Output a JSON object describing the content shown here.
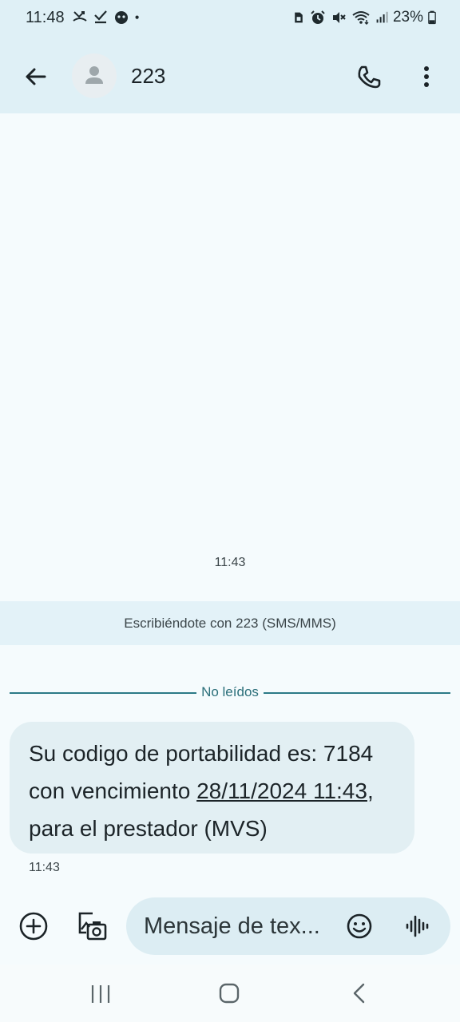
{
  "status_bar": {
    "time": "11:48",
    "battery": "23%",
    "left_icons": [
      "missed-call-icon",
      "check-icon",
      "app-notification-icon",
      "dot-icon"
    ],
    "right_icons": [
      "sim-icon",
      "alarm-icon",
      "mute-icon",
      "wifi-icon",
      "signal-icon",
      "battery-icon"
    ]
  },
  "header": {
    "contact_name": "223",
    "icons": [
      "back-arrow-icon",
      "avatar-icon",
      "phone-icon",
      "more-vert-icon"
    ]
  },
  "conversation": {
    "timestamp_top": "11:43",
    "banner": "Escribiéndote con 223 (SMS/MMS)",
    "unread_divider": "No leídos",
    "message": {
      "part1": "Su codigo de portabilidad es: 7184 con vencimiento ",
      "link1": "28/11/2024 11:43",
      "part2": ", para el prestador (MVS)",
      "time": "11:43"
    }
  },
  "compose": {
    "placeholder": "Mensaje de tex...",
    "icons": [
      "add-icon",
      "gallery-icon",
      "emoji-icon",
      "voice-icon"
    ]
  },
  "colors": {
    "header_bg": "#dff0f6",
    "page_bg": "#f5fbfd",
    "bubble_bg": "#e2eff3",
    "divider_accent": "#2b7a87"
  }
}
